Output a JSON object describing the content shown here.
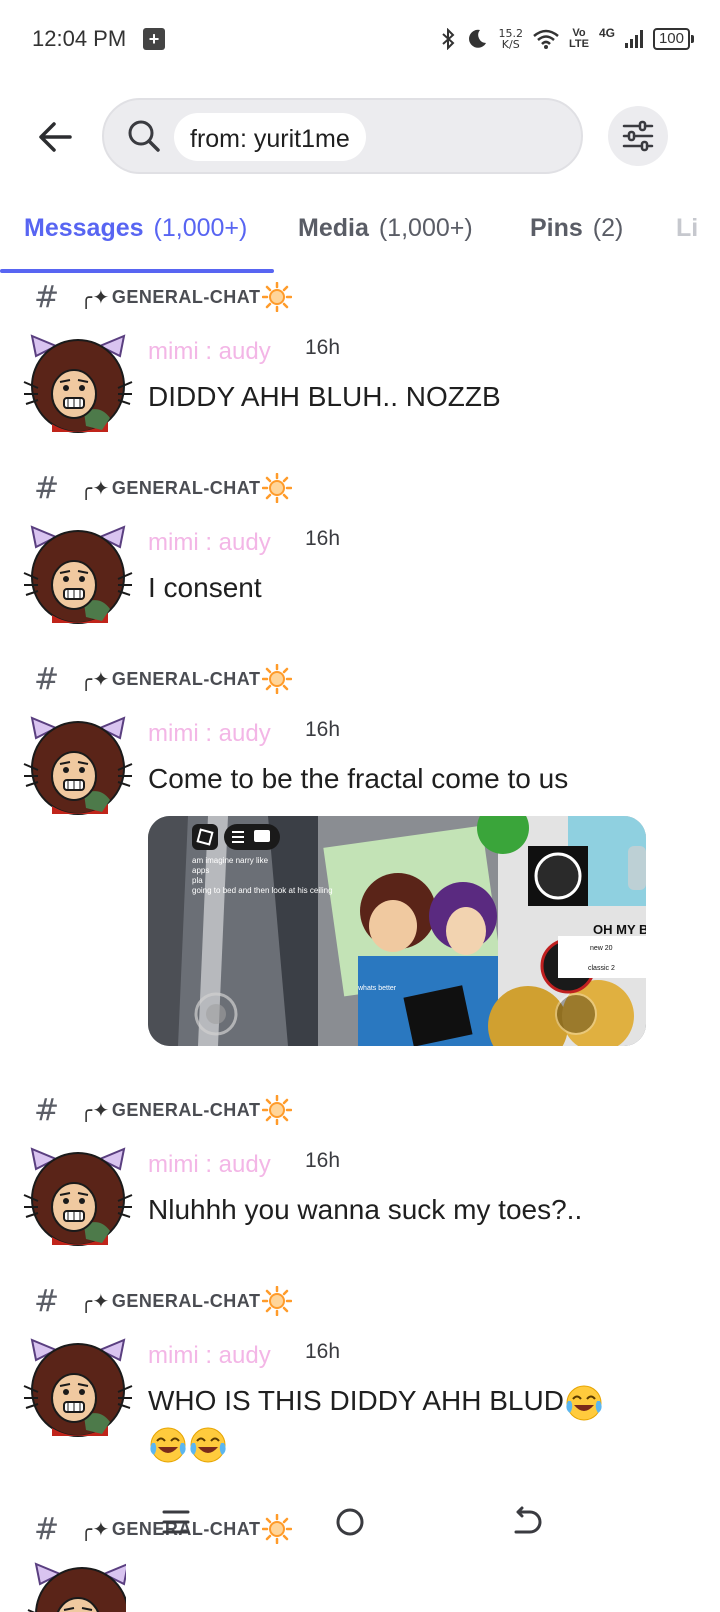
{
  "status_bar": {
    "time": "12:04 PM",
    "speed_value": "15.2",
    "speed_unit": "K/S",
    "volte_top": "Vo",
    "volte_bottom": "LTE",
    "network": "4G",
    "battery": "100",
    "icons": [
      "notification-plus-icon",
      "bluetooth-icon",
      "moon-icon",
      "wifi-icon",
      "signal-icon",
      "battery-icon"
    ]
  },
  "header": {
    "search_query": "from: yurit1me"
  },
  "tabs": [
    {
      "label": "Messages",
      "count": "(1,000+)",
      "active": true
    },
    {
      "label": "Media",
      "count": "(1,000+)",
      "active": false
    },
    {
      "label": "Pins",
      "count": "(2)",
      "active": false
    },
    {
      "label": "Li",
      "count": "",
      "active": false
    }
  ],
  "channel_name": "GENERAL-CHAT",
  "messages": [
    {
      "channel": "GENERAL-CHAT",
      "author": "mimi : audy",
      "time": "16h",
      "text": "DIDDY AHH BLUH.. NOZZB"
    },
    {
      "channel": "GENERAL-CHAT",
      "author": "mimi : audy",
      "time": "16h",
      "text": "I consent"
    },
    {
      "channel": "GENERAL-CHAT",
      "author": "mimi : audy",
      "time": "16h",
      "text": "Come to be the fractal come to us",
      "attachment": {
        "chat_lines": [
          "am imagine narry like",
          "apps",
          "pla",
          "going to bed and then look at his ceiling"
        ],
        "sign_text": "OH MY BR",
        "menu_items": [
          "new 20",
          "classic 2"
        ],
        "board_text": "whats better"
      }
    },
    {
      "channel": "GENERAL-CHAT",
      "author": "mimi : audy",
      "time": "16h",
      "text": "Nluhhh you wanna suck my toes?.."
    },
    {
      "channel": "GENERAL-CHAT",
      "author": "mimi : audy",
      "time": "16h",
      "text": "WHO IS THIS DIDDY AHH BLUD"
    },
    {
      "channel": "GENERAL-CHAT",
      "author": "",
      "time": "",
      "text": ""
    }
  ],
  "colors": {
    "accent": "#5865f2",
    "author": "#f3b6e6",
    "tab_inactive": "#5a5d66",
    "search_bg": "#ececef"
  }
}
